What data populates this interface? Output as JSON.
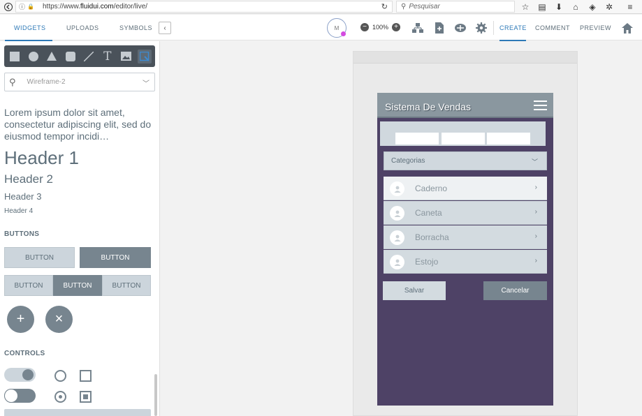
{
  "browser": {
    "url_prefix": "https://www.",
    "url_domain": "fluidui.com",
    "url_path": "/editor/live/",
    "search_placeholder": "Pesquisar"
  },
  "toolbar": {
    "left_tabs": [
      "WIDGETS",
      "UPLOADS",
      "SYMBOLS"
    ],
    "avatar_initial": "M",
    "zoom": "100%",
    "right_tabs": [
      "CREATE",
      "COMMENT",
      "PREVIEW"
    ]
  },
  "panel": {
    "select_value": "Wireframe-2",
    "lorem": "Lorem ipsum dolor sit amet, consectetur adipiscing elit, sed do eiusmod tempor incidi…",
    "header1": "Header 1",
    "header2": "Header 2",
    "header3": "Header 3",
    "header4": "Header 4",
    "buttons_title": "BUTTONS",
    "button_label": "BUTTON",
    "controls_title": "CONTROLS",
    "fab_add": "+",
    "fab_close": "×"
  },
  "app": {
    "title": "Sistema De Vendas",
    "category_select": "Categorias",
    "items": [
      "Caderno",
      "Caneta",
      "Borracha",
      "Estojo"
    ],
    "save_label": "Salvar",
    "cancel_label": "Cancelar"
  },
  "colors": {
    "accent": "#2d79b7",
    "phone_bg": "#4e4266",
    "widget_gray": "#77858f"
  }
}
